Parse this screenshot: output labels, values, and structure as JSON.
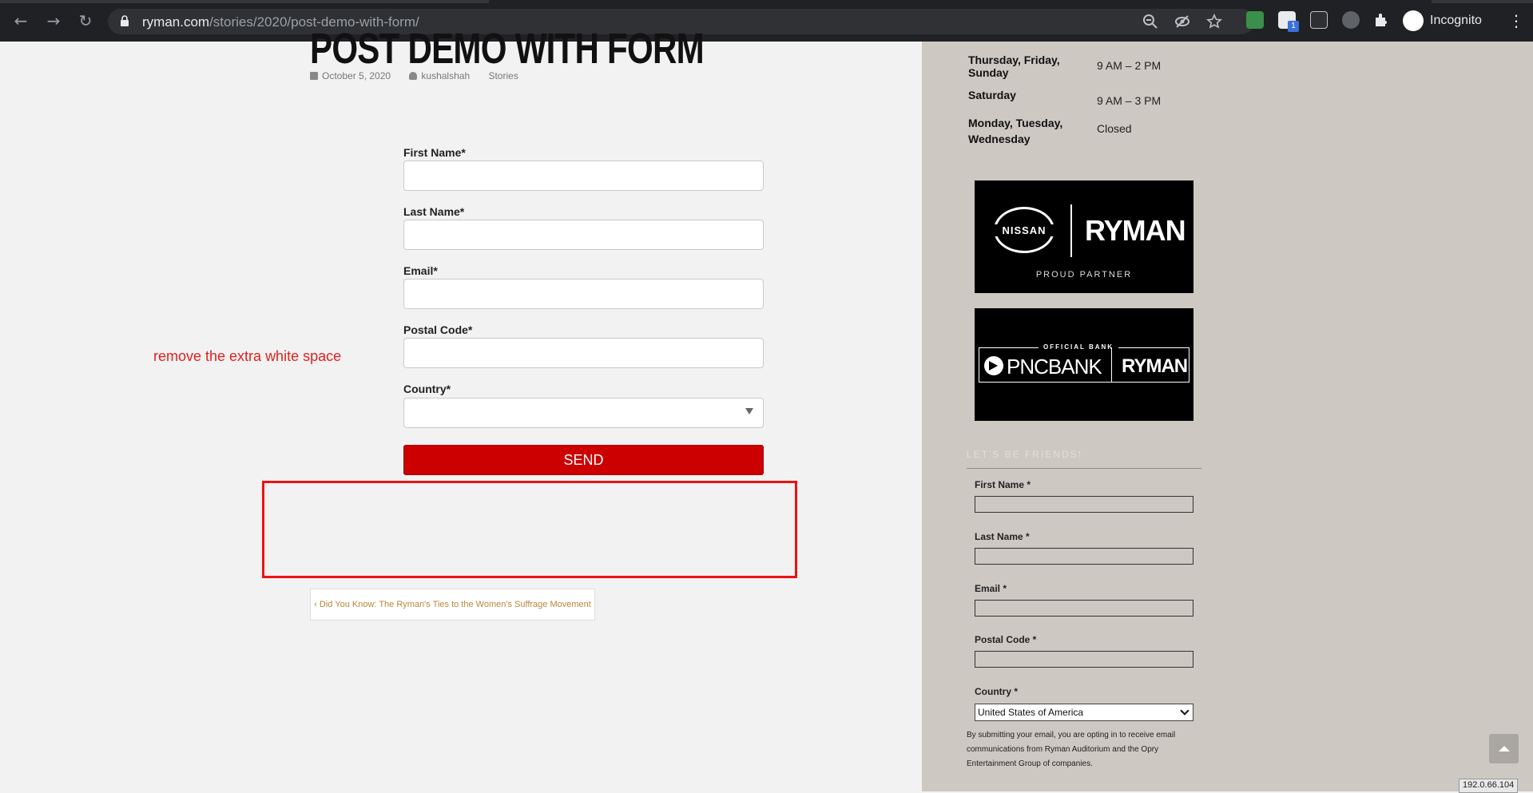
{
  "browser": {
    "url_host": "ryman.com",
    "url_path": "/stories/2020/post-demo-with-form/",
    "profile_label": "Incognito",
    "extension_badge": "1",
    "icons": [
      "back-arrow-icon",
      "forward-arrow-icon",
      "reload-icon",
      "lock-icon",
      "zoom-icon",
      "eye-off-icon",
      "star-icon",
      "extension-puzzle-icon",
      "incognito-icon",
      "kebab-menu-icon"
    ]
  },
  "post": {
    "title": "POST DEMO WITH FORM",
    "date": "October 5, 2020",
    "author": "kushalshah",
    "category": "Stories"
  },
  "form": {
    "fields": [
      {
        "label": "First Name*",
        "value": ""
      },
      {
        "label": "Last Name*",
        "value": ""
      },
      {
        "label": "Email*",
        "value": ""
      },
      {
        "label": "Postal Code*",
        "value": ""
      },
      {
        "label": "Country*",
        "value": ""
      }
    ],
    "submit_label": "SEND"
  },
  "annotation": {
    "note": "remove the extra white space",
    "color": "#ee1111"
  },
  "navigation": {
    "prev_post": "Did You Know: The Ryman's Ties to the Women's Suffrage Movement"
  },
  "sidebar": {
    "hours": [
      {
        "days": "Thursday, Friday, Sunday",
        "time": "9 AM – 2 PM"
      },
      {
        "days": "Saturday",
        "time": "9 AM – 3 PM"
      },
      {
        "days": "Monday, Tuesday, Wednesday",
        "time": "Closed"
      }
    ],
    "partner1": {
      "brand": "NISSAN",
      "venue": "RYMAN",
      "tagline": "PROUD PARTNER"
    },
    "partner2": {
      "label": "OFFICIAL BANK",
      "brand": "PNCBANK",
      "venue": "RYMAN"
    },
    "newsletter": {
      "heading": "LET'S BE FRIENDS!",
      "fields": [
        {
          "label": "First Name *",
          "value": ""
        },
        {
          "label": "Last Name *",
          "value": ""
        },
        {
          "label": "Email *",
          "value": ""
        },
        {
          "label": "Postal Code *",
          "value": ""
        }
      ],
      "country_label": "Country *",
      "country_value": "United States of America",
      "disclaimer": "By submitting your email, you are opting in to receive email communications from Ryman Auditorium and the Opry Entertainment Group of companies."
    }
  },
  "status": {
    "ip": "192.0.66.104"
  },
  "colors": {
    "accent_red": "#cc0000",
    "sidebar_bg": "#cdc8c1",
    "page_bg": "#f2f2f2",
    "link_gold": "#b8863b"
  }
}
